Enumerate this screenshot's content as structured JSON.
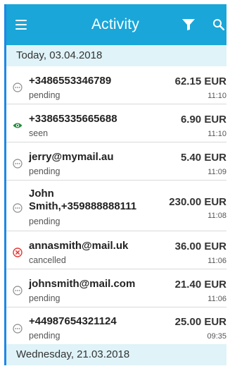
{
  "header": {
    "title": "Activity",
    "menu_icon": "hamburger-menu-icon",
    "filter_icon": "filter-funnel-icon",
    "search_icon": "search-icon"
  },
  "colors": {
    "app_bar": "#1aa6d8",
    "date_header_bg": "#dff3f8",
    "seen": "#1f8a3a",
    "cancelled": "#e53935",
    "pending": "#8a8a8a"
  },
  "sections": [
    {
      "date": "Today, 03.04.2018",
      "items": [
        {
          "name": "+3486553346789",
          "status": "pending",
          "amount": "62.15 EUR",
          "time": "11:10",
          "icon": "pending-dots-icon"
        },
        {
          "name": "+33865335665688",
          "status": "seen",
          "amount": "6.90 EUR",
          "time": "11:10",
          "icon": "eye-icon"
        },
        {
          "name": "jerry@mymail.au",
          "status": "pending",
          "amount": "5.40 EUR",
          "time": "11:09",
          "icon": "pending-dots-icon"
        },
        {
          "name_line1": "John",
          "name_line2": "Smith,+359888888111",
          "status": "pending",
          "amount": "230.00 EUR",
          "time": "11:08",
          "icon": "pending-dots-icon"
        },
        {
          "name": "annasmith@mail.uk",
          "status": "cancelled",
          "amount": "36.00 EUR",
          "time": "11:06",
          "icon": "cancel-x-icon"
        },
        {
          "name": "johnsmith@mail.com",
          "status": "pending",
          "amount": "21.40 EUR",
          "time": "11:06",
          "icon": "pending-dots-icon"
        },
        {
          "name": "+44987654321124",
          "status": "pending",
          "amount": "25.00 EUR",
          "time": "09:35",
          "icon": "pending-dots-icon"
        }
      ]
    },
    {
      "date": "Wednesday, 21.03.2018",
      "items": []
    }
  ]
}
